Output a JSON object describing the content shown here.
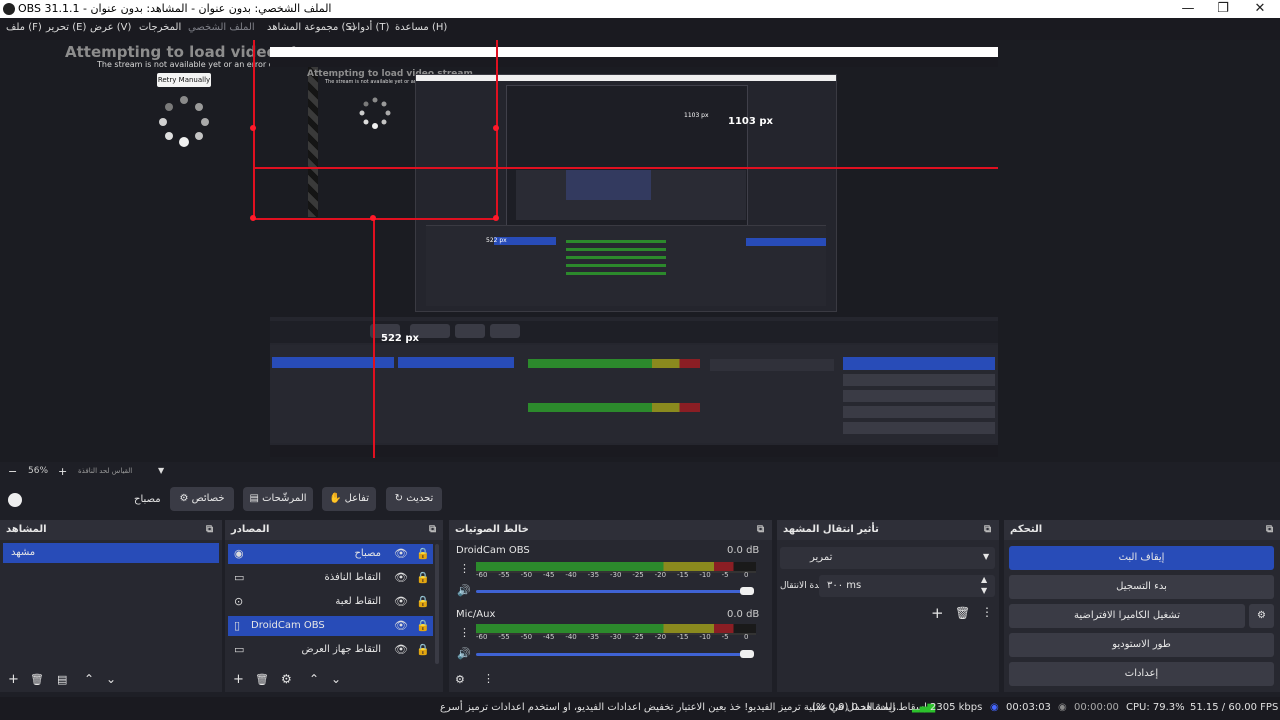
{
  "window": {
    "title": "OBS 31.1.1 - الملف الشخصي: بدون عنوان - المشاهد: بدون عنوان",
    "min": "—",
    "max": "❐",
    "close": "✕"
  },
  "menu": [
    "ملف (F)",
    "تحرير (E)",
    "عرض (V)",
    "المخرجات",
    "الملف الشخصي",
    "مجموعة المشاهد (S)",
    "أدوات (T)",
    "مساعدة (H)"
  ],
  "preview": {
    "loading_title": "Attempting to load video stream.",
    "loading_sub": "The stream is not available yet or an error occured.",
    "retry": "Retry Manually",
    "nested_title": "Attempting to load video stream.",
    "nested_sub": "The stream is not available yet or an error occured.",
    "measure_h": "1103 px",
    "measure_v": "522 px",
    "nested_h": "1103 px",
    "nested_v": "522 px"
  },
  "zoom": {
    "minus": "−",
    "value": "56%",
    "plus": "+",
    "fit": "القياس لحد النافذة"
  },
  "toolbar": {
    "source_name": "مصباح",
    "properties": "خصائص",
    "filters": "المرشّحات",
    "interact": "تفاعل",
    "refresh": "تحديث"
  },
  "docks": {
    "scenes": {
      "title": "المشاهد",
      "items": [
        "مشهد"
      ]
    },
    "sources": {
      "title": "المصادر",
      "items": [
        "مصباح",
        "التقاط النافذة",
        "التقاط لعبة",
        "DroidCam OBS",
        "التقاط جهاز العرض"
      ]
    },
    "mixer": {
      "title": "خالط الصوتيات",
      "channels": [
        {
          "name": "DroidCam OBS",
          "db": "0.0 dB",
          "level": 0.92
        },
        {
          "name": "Mic/Aux",
          "db": "0.0 dB",
          "level": 0.92
        }
      ],
      "scale": [
        "-60",
        "-55",
        "-50",
        "-45",
        "-40",
        "-35",
        "-30",
        "-25",
        "-20",
        "-15",
        "-10",
        "-5",
        "0"
      ]
    },
    "transitions": {
      "title": "تأثير انتقال المشهد",
      "selected": "تمرير",
      "duration_label": "مدة الانتقال",
      "duration": "٣٠٠ ms"
    },
    "controls": {
      "title": "التحكم",
      "buttons": [
        "إيقاف البث",
        "بدء التسجيل",
        "تشغيل الكاميرا الافتراضية",
        "طور الاستوديو",
        "إعدادات"
      ]
    }
  },
  "status": {
    "message": "زيادة الحمل في عملية ترميز الفيديو! خذ بعين الاعتبار تخفيض اعدادات الفيديو، او استخدم اعدادات ترميز أسرع.",
    "dropped": "إسقاط المشاهد 0 (0.0 %)",
    "bitrate": "2305 kbps",
    "stream_time": "00:03:03",
    "rec_time": "00:00:00",
    "cpu": "CPU: 79.3%",
    "fps": "51.15 / 60.00 FPS"
  },
  "colors": {
    "accent": "#284cb8",
    "meter_green": "#2c8a2c",
    "meter_yellow": "#8a8a1e",
    "meter_red": "#8a1e24",
    "guide_red": "#e01020"
  }
}
